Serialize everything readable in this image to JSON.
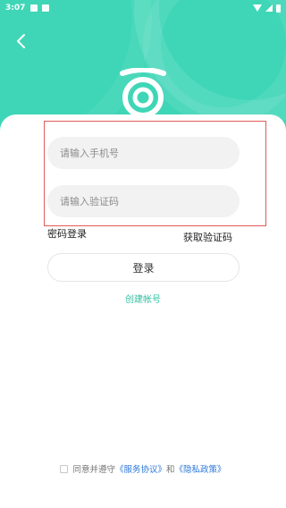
{
  "status": {
    "time": "3:07",
    "icons": [
      "image-icon",
      "notification-icon",
      "wifi-icon",
      "signal-icon",
      "battery-icon"
    ]
  },
  "header": {
    "back_icon": "chevron-left-icon",
    "logo": "app-logo",
    "bg_color": "#3fd6b7"
  },
  "form": {
    "phone_placeholder": "请输入手机号",
    "code_placeholder": "请输入验证码",
    "password_login": "密码登录",
    "get_code": "获取验证码",
    "login": "登录",
    "create_account": "创建帐号"
  },
  "agreement": {
    "prefix": "同意并遵守",
    "service": "《服务协议》",
    "and": "和",
    "privacy": "《隐私政策》"
  },
  "colors": {
    "accent": "#2fbfa0",
    "link": "#2b78d8",
    "highlight": "#e15a5a"
  }
}
